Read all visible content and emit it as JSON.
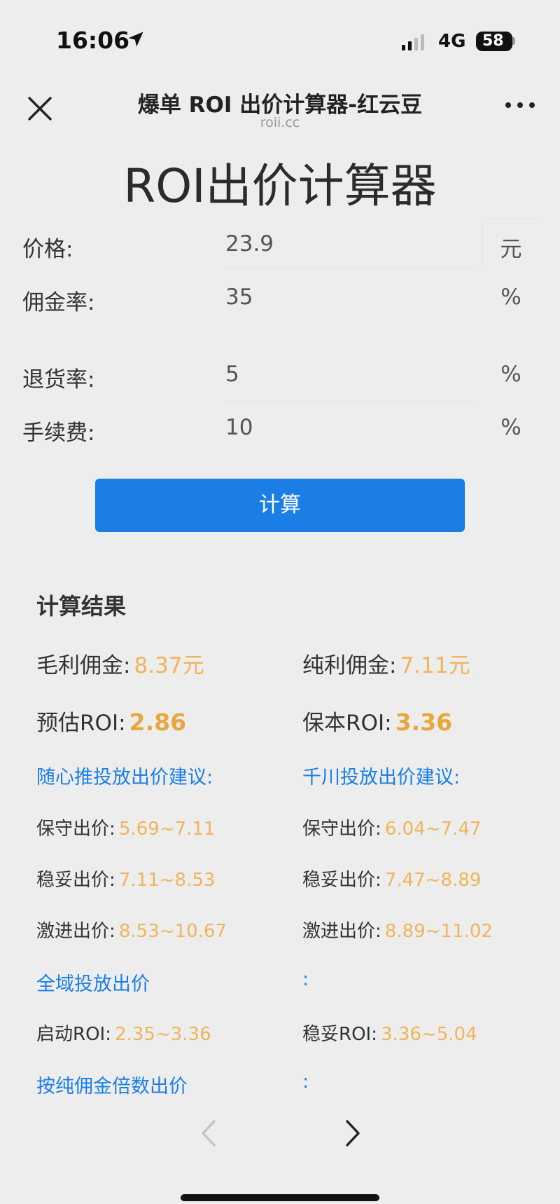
{
  "status_bar": {
    "time": "16:06",
    "network": "4G",
    "battery": "58"
  },
  "nav": {
    "title": "爆单 ROI 出价计算器-红云豆",
    "subtitle": "roii.cc"
  },
  "page_title": "ROI出价计算器",
  "form": {
    "price": {
      "label": "价格:",
      "value": "23.9",
      "unit": "元"
    },
    "commission": {
      "label": "佣金率:",
      "value": "35",
      "unit": "%"
    },
    "return_rate": {
      "label": "退货率:",
      "value": "5",
      "unit": "%"
    },
    "fee": {
      "label": "手续费:",
      "value": "10",
      "unit": "%"
    }
  },
  "calc_button": "计算",
  "results": {
    "heading": "计算结果",
    "gross_commission": {
      "label": "毛利佣金:",
      "value": "8.37元"
    },
    "net_commission": {
      "label": "纯利佣金:",
      "value": "7.11元"
    },
    "est_roi": {
      "label": "预估ROI:",
      "value": "2.86"
    },
    "breakeven_roi": {
      "label": "保本ROI:",
      "value": "3.36"
    },
    "suixin": {
      "heading": "随心推投放出价建议:",
      "conservative": {
        "label": "保守出价:",
        "value": "5.69~7.11"
      },
      "steady": {
        "label": "稳妥出价:",
        "value": "7.11~8.53"
      },
      "aggressive": {
        "label": "激进出价:",
        "value": "8.53~10.67"
      }
    },
    "qianchuan": {
      "heading": "千川投放出价建议:",
      "conservative": {
        "label": "保守出价:",
        "value": "6.04~7.47"
      },
      "steady": {
        "label": "稳妥出价:",
        "value": "7.47~8.89"
      },
      "aggressive": {
        "label": "激进出价:",
        "value": "8.89~11.02"
      }
    },
    "global": {
      "heading": "全域投放出价",
      "colon": ":",
      "start_roi": {
        "label": "启动ROI:",
        "value": "2.35~3.36"
      },
      "steady_roi": {
        "label": "稳妥ROI:",
        "value": "3.36~5.04"
      }
    },
    "pure_multiple": {
      "heading": "按纯佣金倍数出价",
      "colon": ":"
    }
  },
  "icons": {
    "location": "location-arrow-icon",
    "close": "close-icon",
    "more": "more-dots-icon",
    "back": "chevron-left-icon",
    "forward": "chevron-right-icon"
  },
  "colors": {
    "accent": "#1a7ee6",
    "value": "#f0b45a",
    "background": "#ededed"
  }
}
